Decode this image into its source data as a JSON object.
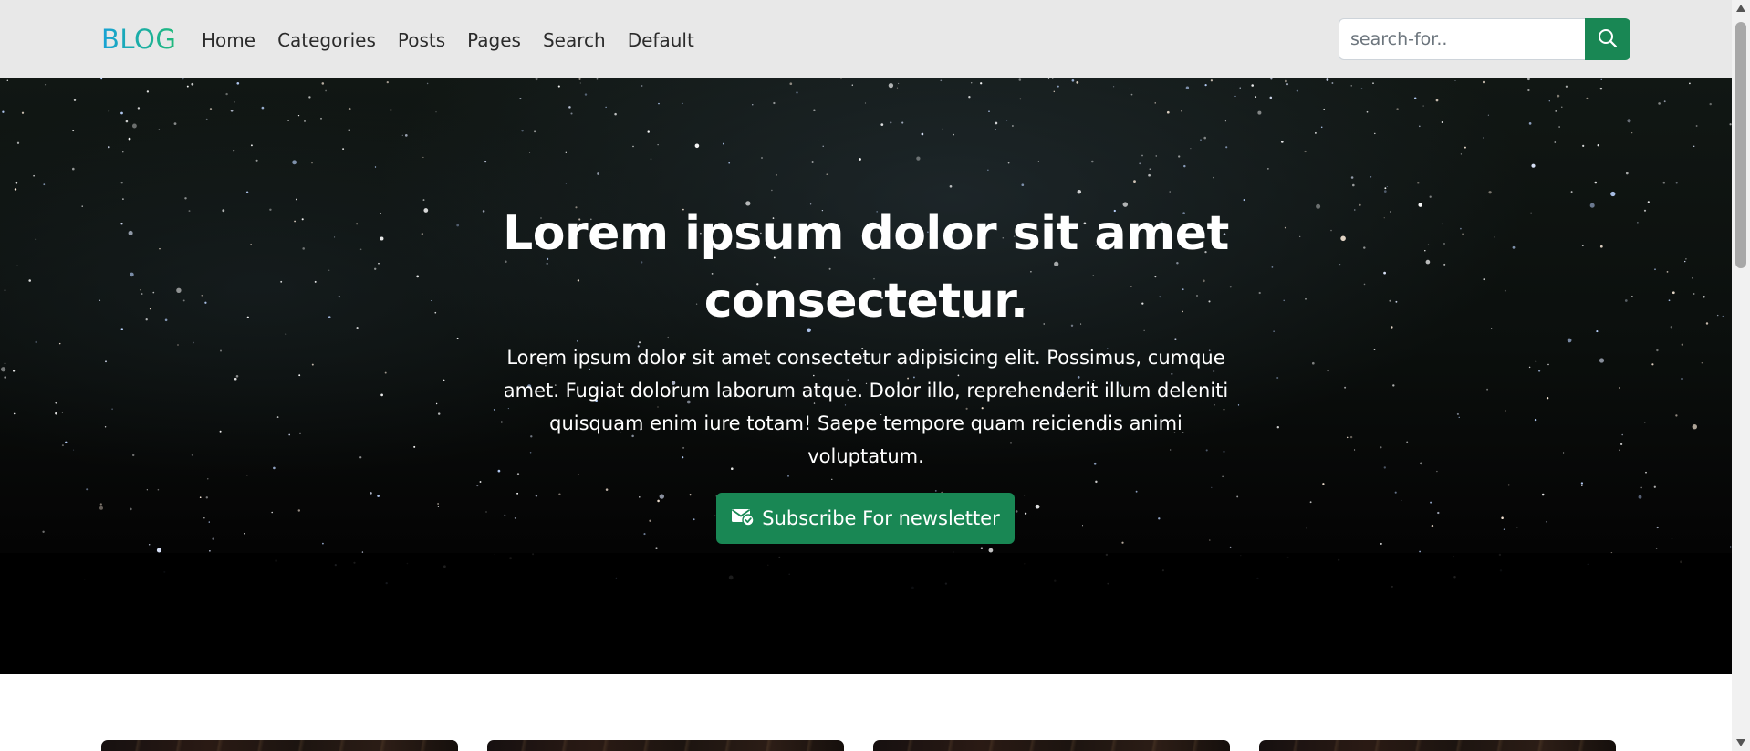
{
  "navbar": {
    "brand": "BLOG",
    "links": [
      "Home",
      "Categories",
      "Posts",
      "Pages",
      "Search",
      "Default"
    ],
    "search": {
      "placeholder": "search-for..",
      "value": "",
      "button_icon": "search-icon"
    }
  },
  "hero": {
    "title": "Lorem ipsum dolor sit amet consectetur.",
    "text": "Lorem ipsum dolor sit amet consectetur adipisicing elit. Possimus, cumque amet. Fugiat dolorum laborum atque. Dolor illo, reprehenderit illum deleniti quisquam enim iure totam! Saepe tempore quam reiciendis animi voluptatum.",
    "button_label": "Subscribe For newsletter",
    "button_icon": "envelope-check-icon"
  },
  "cards_count": 4,
  "colors": {
    "accent": "#198754",
    "brand_gradient_start": "#17a2d6",
    "brand_gradient_end": "#20b97a",
    "navbar_bg": "#e8e8e8"
  }
}
